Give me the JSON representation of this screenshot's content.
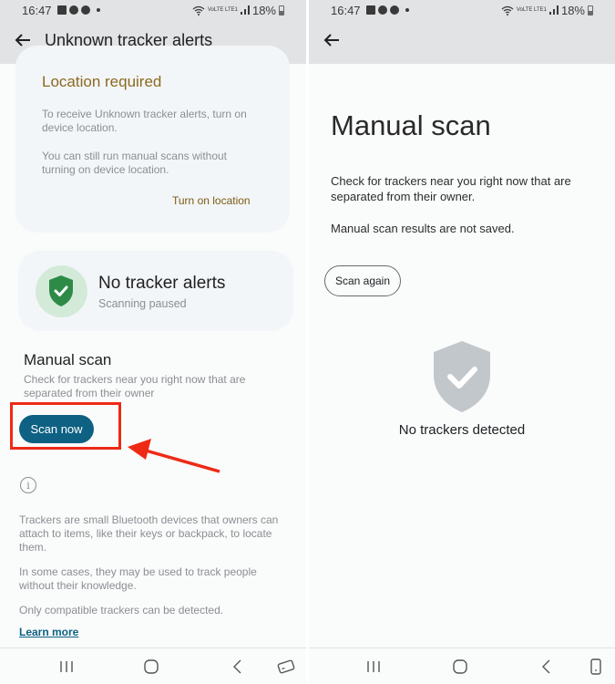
{
  "status_bar": {
    "time": "16:47",
    "battery": "18%",
    "network": "VoLTE LTE1"
  },
  "left_screen": {
    "app_title": "Unknown tracker alerts",
    "location_card": {
      "title": "Location required",
      "text1": "To receive Unknown tracker alerts, turn on device location.",
      "text2": "You can still run manual scans without turning on device location.",
      "action": "Turn on location"
    },
    "status_card": {
      "title": "No tracker alerts",
      "subtitle": "Scanning paused"
    },
    "manual_scan": {
      "title": "Manual scan",
      "description": "Check for trackers near you right now that are separated from their owner",
      "button": "Scan now"
    },
    "info": {
      "icon": "info-icon",
      "text1": "Trackers are small Bluetooth devices that owners can attach to items, like their keys or backpack, to locate them.",
      "text2": "In some cases, they may be used to track people without their knowledge.",
      "text3": "Only compatible trackers can be detected.",
      "link": "Learn more"
    }
  },
  "right_screen": {
    "title": "Manual scan",
    "text1": "Check for trackers near you right now that are separated from their owner.",
    "text2": "Manual scan results are not saved.",
    "button": "Scan again",
    "result": "No trackers detected"
  },
  "colors": {
    "accent": "#0e6183",
    "highlight": "#ee2a16",
    "shield_green": "#2e8b47",
    "shield_gray": "#c1c7cb",
    "location_title": "#8a6a1f"
  }
}
